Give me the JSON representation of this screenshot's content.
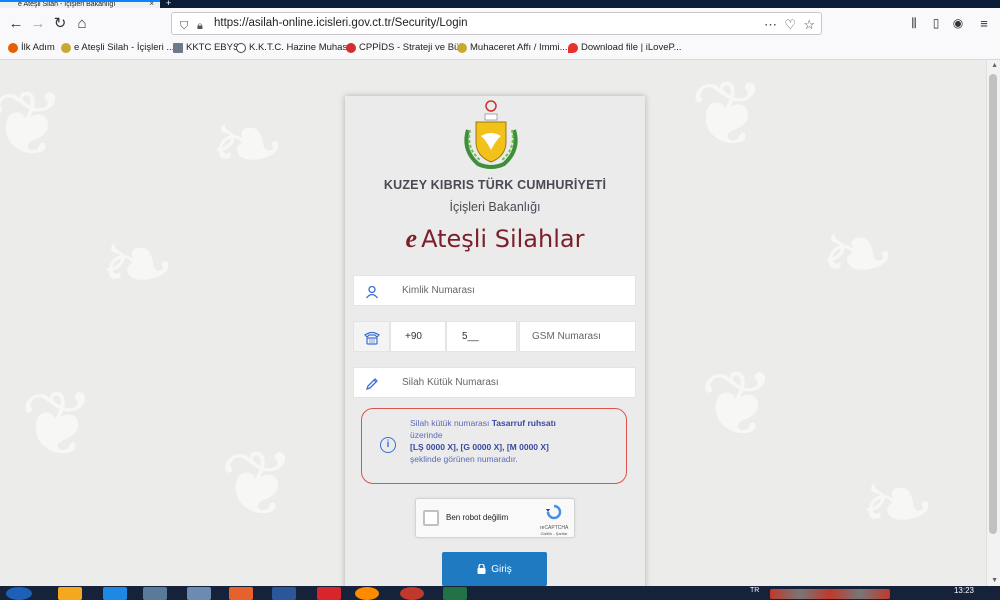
{
  "browser": {
    "tab_title": "e Ateşli Silah - İçişleri Bakanlığı",
    "url": "https://asilah-online.icisleri.gov.ct.tr/Security/Login",
    "more_icon": "⋯",
    "bookmarks": [
      {
        "label": "İlk Adım",
        "color": "#e66000"
      },
      {
        "label": "e Ateşli Silah - İçişleri ...",
        "color": "#c7a830"
      },
      {
        "label": "KKTC EBYS",
        "color": "#6b7b8c"
      },
      {
        "label": "K.K.T.C. Hazine Muhas...",
        "color": "#444444"
      },
      {
        "label": "CPPİDS - Strateji ve Bü...",
        "color": "#d0312d"
      },
      {
        "label": "Muhaceret Affı / Immi...",
        "color": "#c7a830"
      },
      {
        "label": "Download file | iLoveP...",
        "color": "#e5322d"
      }
    ]
  },
  "login": {
    "gov_name": "KUZEY KIBRIS TÜRK CUMHURİYETİ",
    "ministry": "İçişleri Bakanlığı",
    "title_prefix": "e",
    "title": "Ateşli Silahlar",
    "id_placeholder": "Kimlik Numarası",
    "phone_country_code": "+90",
    "phone_prefix": "5__",
    "gsm_placeholder": "GSM Numarası",
    "license_placeholder": "Silah Kütük Numarası",
    "info": {
      "line1_normal": "Silah kütük numarası",
      "line1_bold": "Tasarruf ruhsatı",
      "line2": "üzerinde",
      "line3_bold": "[LŞ 0000 X], [G 0000 X], [M 0000 X]",
      "line4": "şeklinde görünen numaradır."
    },
    "recaptcha": {
      "label": "Ben robot değilim",
      "brand": "reCAPTCHA",
      "links": "Gizlilik - Şartlar"
    },
    "login_button": "Giriş"
  },
  "taskbar": {
    "language": "TR",
    "time": "13:23"
  },
  "colors": {
    "accent": "#1f7ac2",
    "title": "#7b1f2a",
    "info_border": "#d9534f",
    "icon_blue": "#3b6fd6"
  }
}
